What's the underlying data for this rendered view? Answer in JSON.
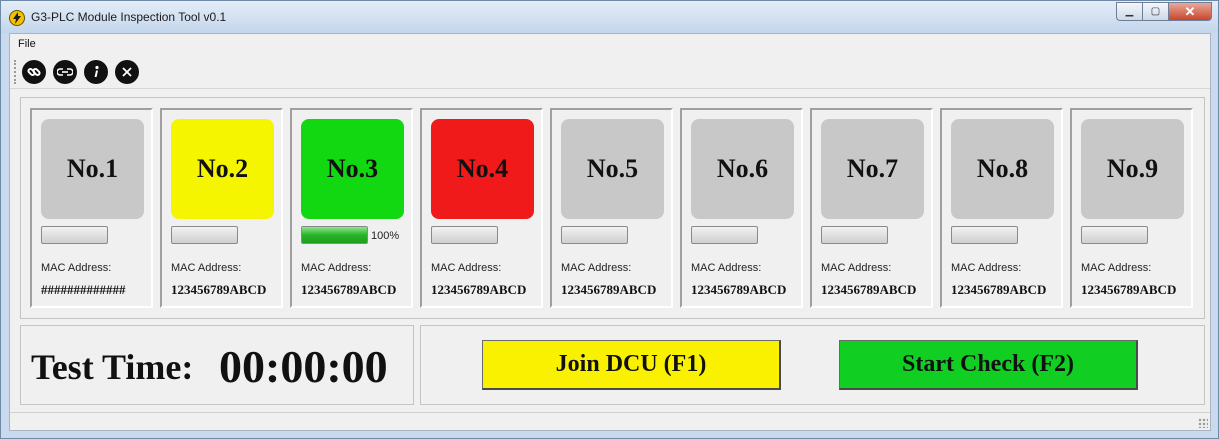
{
  "window": {
    "title": "G3-PLC Module Inspection Tool v0.1",
    "minimize": "▁",
    "maximize": "▢",
    "close": "✕"
  },
  "menu": {
    "file": "File"
  },
  "toolbar": {
    "icons": [
      "link-icon",
      "unlink-icon",
      "info-icon",
      "close-icon"
    ]
  },
  "modules": [
    {
      "label": "No.1",
      "color": "#c8c8c8",
      "progress": 0,
      "progress_text": "",
      "mac_label": "MAC Address:",
      "mac_value": "#############"
    },
    {
      "label": "No.2",
      "color": "#f5f500",
      "progress": 0,
      "progress_text": "",
      "mac_label": "MAC Address:",
      "mac_value": "123456789ABCD"
    },
    {
      "label": "No.3",
      "color": "#12d812",
      "progress": 1.0,
      "progress_text": "100%",
      "mac_label": "MAC Address:",
      "mac_value": "123456789ABCD"
    },
    {
      "label": "No.4",
      "color": "#f01a1a",
      "progress": 0,
      "progress_text": "",
      "mac_label": "MAC Address:",
      "mac_value": "123456789ABCD"
    },
    {
      "label": "No.5",
      "color": "#c8c8c8",
      "progress": 0,
      "progress_text": "",
      "mac_label": "MAC Address:",
      "mac_value": "123456789ABCD"
    },
    {
      "label": "No.6",
      "color": "#c8c8c8",
      "progress": 0,
      "progress_text": "",
      "mac_label": "MAC Address:",
      "mac_value": "123456789ABCD"
    },
    {
      "label": "No.7",
      "color": "#c8c8c8",
      "progress": 0,
      "progress_text": "",
      "mac_label": "MAC Address:",
      "mac_value": "123456789ABCD"
    },
    {
      "label": "No.8",
      "color": "#c8c8c8",
      "progress": 0,
      "progress_text": "",
      "mac_label": "MAC Address:",
      "mac_value": "123456789ABCD"
    },
    {
      "label": "No.9",
      "color": "#c8c8c8",
      "progress": 0,
      "progress_text": "",
      "mac_label": "MAC Address:",
      "mac_value": "123456789ABCD"
    }
  ],
  "test_time": {
    "label": "Test Time:",
    "value": "00:00:00"
  },
  "actions": {
    "join": {
      "label": "Join DCU (F1)",
      "color": "#f9f100"
    },
    "start": {
      "label": "Start Check (F2)",
      "color": "#10cf22"
    }
  }
}
